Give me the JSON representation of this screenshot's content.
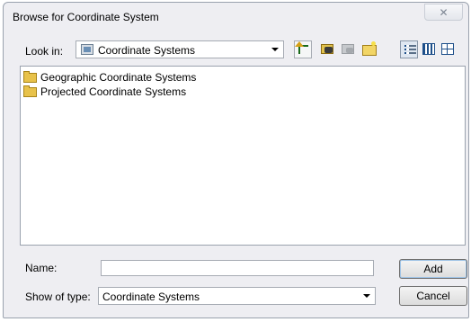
{
  "window": {
    "title": "Browse for Coordinate System",
    "close_glyph": "✕"
  },
  "look_in": {
    "label": "Look in:",
    "value": "Coordinate Systems",
    "icon": "coordinate-systems-icon"
  },
  "toolbar": {
    "buttons": [
      "up-one-level-icon",
      "connect-folder-icon",
      "disconnect-folder-icon",
      "new-folder-icon",
      "list-view-icon",
      "details-view-icon",
      "thumbnails-view-icon"
    ]
  },
  "file_list": {
    "items": [
      {
        "label": "Geographic Coordinate Systems",
        "icon": "folder-icon"
      },
      {
        "label": "Projected Coordinate Systems",
        "icon": "folder-icon"
      }
    ]
  },
  "name_field": {
    "label": "Name:",
    "value": ""
  },
  "type_field": {
    "label": "Show of type:",
    "value": "Coordinate Systems"
  },
  "buttons": {
    "add": "Add",
    "cancel": "Cancel"
  },
  "colors": {
    "dialog_bg": "#eeeef2",
    "folder": "#e8c24a"
  }
}
